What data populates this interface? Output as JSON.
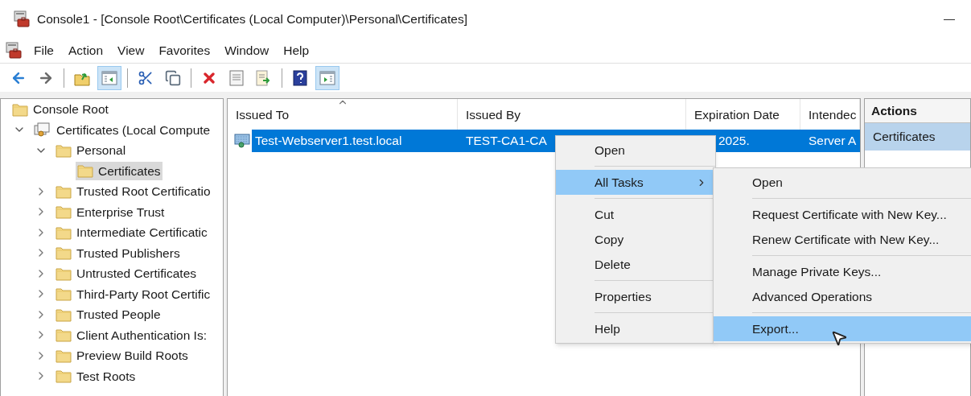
{
  "window": {
    "title": "Console1 - [Console Root\\Certificates (Local Computer)\\Personal\\Certificates]"
  },
  "menu_bar": [
    "File",
    "Action",
    "View",
    "Favorites",
    "Window",
    "Help"
  ],
  "toolbar": [
    {
      "kind": "back",
      "selected": false
    },
    {
      "kind": "forward",
      "selected": false
    },
    {
      "kind": "separator"
    },
    {
      "kind": "up",
      "selected": false
    },
    {
      "kind": "tree",
      "selected": true
    },
    {
      "kind": "separator"
    },
    {
      "kind": "cut",
      "selected": false
    },
    {
      "kind": "copy",
      "selected": false
    },
    {
      "kind": "separator"
    },
    {
      "kind": "delete",
      "selected": false
    },
    {
      "kind": "properties",
      "selected": false
    },
    {
      "kind": "export",
      "selected": false
    },
    {
      "kind": "separator"
    },
    {
      "kind": "help",
      "selected": false
    },
    {
      "kind": "pane",
      "selected": true
    }
  ],
  "tree": [
    {
      "label": "Console Root",
      "kind": "folder",
      "selected": false,
      "children": [
        {
          "label": "Certificates (Local Compute",
          "kind": "store",
          "selected": false,
          "expanded": true,
          "children": [
            {
              "label": "Personal",
              "kind": "folder",
              "selected": false,
              "expanded": true,
              "children": [
                {
                  "label": "Certificates",
                  "kind": "folder",
                  "selected": true
                }
              ]
            },
            {
              "label": "Trusted Root Certificatio",
              "kind": "folder",
              "selected": false,
              "expanded": false
            },
            {
              "label": "Enterprise Trust",
              "kind": "folder",
              "selected": false,
              "expanded": false
            },
            {
              "label": "Intermediate Certificatic",
              "kind": "folder",
              "selected": false,
              "expanded": false
            },
            {
              "label": "Trusted Publishers",
              "kind": "folder",
              "selected": false,
              "expanded": false
            },
            {
              "label": "Untrusted Certificates",
              "kind": "folder",
              "selected": false,
              "expanded": false
            },
            {
              "label": "Third-Party Root Certific",
              "kind": "folder",
              "selected": false,
              "expanded": false
            },
            {
              "label": "Trusted People",
              "kind": "folder",
              "selected": false,
              "expanded": false
            },
            {
              "label": "Client Authentication Is:",
              "kind": "folder",
              "selected": false,
              "expanded": false
            },
            {
              "label": "Preview Build Roots",
              "kind": "folder",
              "selected": false,
              "expanded": false
            },
            {
              "label": "Test Roots",
              "kind": "folder",
              "selected": false,
              "expanded": false
            }
          ]
        }
      ]
    }
  ],
  "table": {
    "columns": [
      {
        "label": "Issued To",
        "sorted": true
      },
      {
        "label": "Issued By",
        "sorted": false
      },
      {
        "label": "Expiration Date",
        "sorted": false
      },
      {
        "label": "Intendec",
        "sorted": false
      }
    ],
    "rows": [
      {
        "cells": [
          "Test-Webserver1.test.local",
          "TEST-CA1-CA",
          "2025.",
          "Server A"
        ],
        "selected": true
      }
    ]
  },
  "actions": {
    "title": "Actions",
    "items": [
      {
        "label": "Certificates",
        "kind": "header",
        "selected": true
      }
    ]
  },
  "context_menu": [
    {
      "kind": "item",
      "label": "Open",
      "selected": false,
      "submenu": false
    },
    {
      "kind": "separator"
    },
    {
      "kind": "item",
      "label": "All Tasks",
      "selected": true,
      "submenu": true
    },
    {
      "kind": "separator"
    },
    {
      "kind": "item",
      "label": "Cut",
      "selected": false,
      "submenu": false
    },
    {
      "kind": "item",
      "label": "Copy",
      "selected": false,
      "submenu": false
    },
    {
      "kind": "item",
      "label": "Delete",
      "selected": false,
      "submenu": false
    },
    {
      "kind": "separator"
    },
    {
      "kind": "item",
      "label": "Properties",
      "selected": false,
      "submenu": false
    },
    {
      "kind": "separator"
    },
    {
      "kind": "item",
      "label": "Help",
      "selected": false,
      "submenu": false
    }
  ],
  "submenu": [
    {
      "kind": "item",
      "label": "Open",
      "selected": false
    },
    {
      "kind": "separator"
    },
    {
      "kind": "item",
      "label": "Request Certificate with New Key...",
      "selected": false
    },
    {
      "kind": "item",
      "label": "Renew Certificate with New Key...",
      "selected": false
    },
    {
      "kind": "separator"
    },
    {
      "kind": "item",
      "label": "Manage Private Keys...",
      "selected": false
    },
    {
      "kind": "item",
      "label": "Advanced Operations",
      "selected": false
    },
    {
      "kind": "separator"
    },
    {
      "kind": "item",
      "label": "Export...",
      "selected": true
    }
  ]
}
